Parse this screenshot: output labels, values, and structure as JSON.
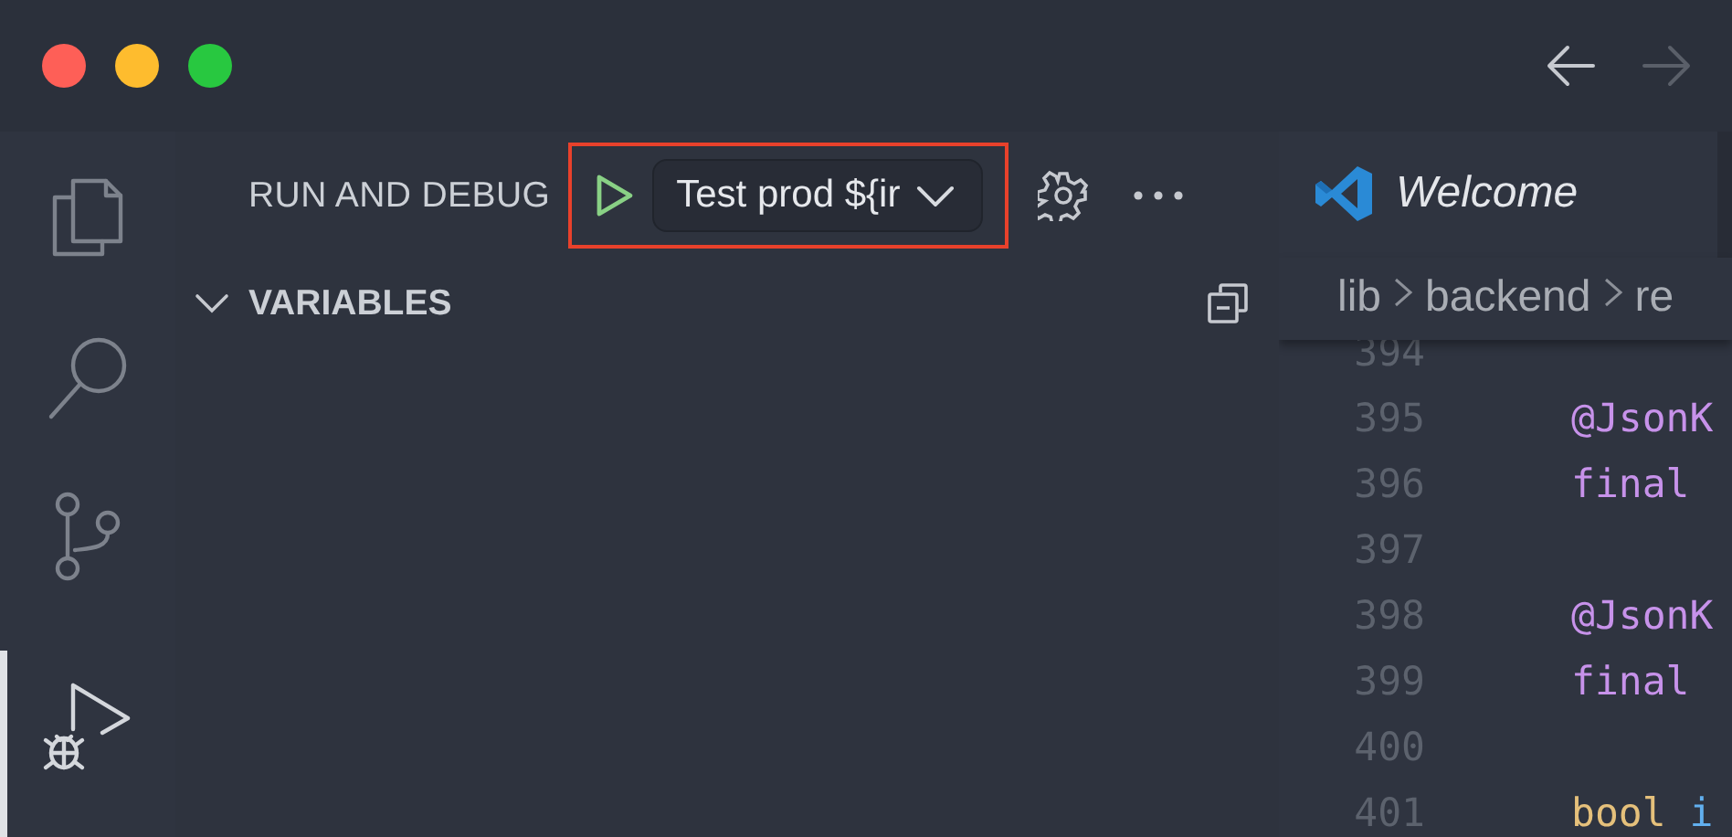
{
  "title_bar": {
    "nav": [
      {
        "kind": "back",
        "disabled": false
      },
      {
        "kind": "forward",
        "disabled": true
      }
    ]
  },
  "activity_bar": [
    {
      "kind": "files",
      "selected": false
    },
    {
      "kind": "search",
      "selected": false
    },
    {
      "kind": "source-control",
      "selected": false
    },
    {
      "kind": "run-debug",
      "selected": true
    }
  ],
  "sidebar": {
    "title": "RUN AND DEBUG",
    "launch": {
      "highlighted": true,
      "configuration": "Test prod ${ir"
    },
    "sections": [
      {
        "title": "VARIABLES",
        "expanded": true
      }
    ]
  },
  "editor": {
    "tabs": [
      {
        "label": "Welcome",
        "selected": true
      }
    ],
    "breadcrumbs": [
      "lib",
      "backend",
      "re"
    ],
    "lines": [
      {
        "number": "394"
      },
      {
        "number": "395",
        "tokens": [
          {
            "text": "@JsonK",
            "kind": "annotation"
          }
        ]
      },
      {
        "number": "396",
        "tokens": [
          {
            "text": "final",
            "kind": "keyword"
          }
        ]
      },
      {
        "number": "397"
      },
      {
        "number": "398",
        "tokens": [
          {
            "text": "@JsonK",
            "kind": "annotation"
          }
        ]
      },
      {
        "number": "399",
        "tokens": [
          {
            "text": "final",
            "kind": "keyword"
          }
        ]
      },
      {
        "number": "400"
      },
      {
        "number": "401",
        "tokens": [
          {
            "text": "bool",
            "kind": "type"
          },
          {
            "text": "i",
            "kind": "identifier"
          }
        ]
      }
    ]
  }
}
